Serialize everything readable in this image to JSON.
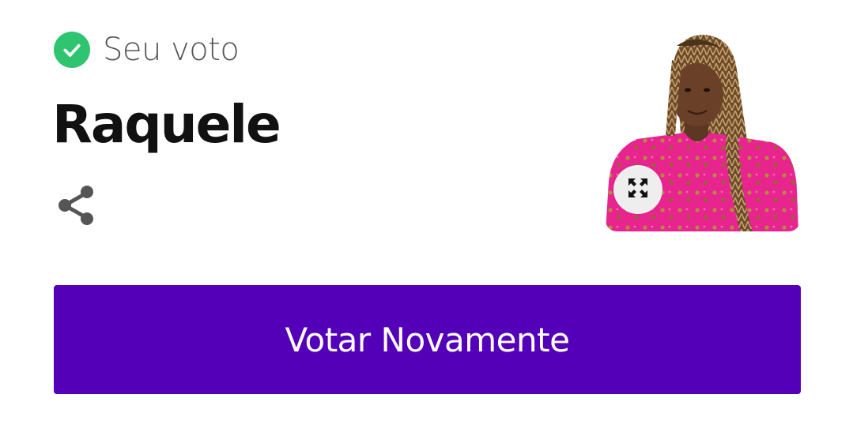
{
  "vote_card": {
    "status_text": "Seu voto",
    "candidate_name": "Raquele",
    "vote_again_label": "Votar Novamente"
  },
  "icons": {
    "status": "check-circle-icon",
    "share": "share-icon",
    "expand": "expand-icon"
  },
  "colors": {
    "check_green": "#2fc46f",
    "button_purple": "#5300b8",
    "name_text": "#111111",
    "status_text": "#555555",
    "button_text": "#ffffff"
  }
}
